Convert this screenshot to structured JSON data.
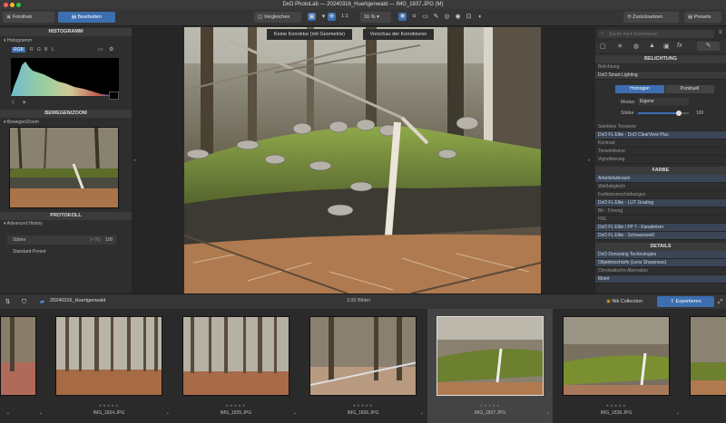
{
  "window": {
    "title": "DxO PhotoLab — 20240316_Huertgenwald — IMG_1837.JPG (M)"
  },
  "tabs": {
    "library": "Fotothek",
    "edit": "Bearbeiten"
  },
  "toolbar": {
    "compare": "Vergleichen",
    "one_to_one": "1:1",
    "zoom": "16 %",
    "reset": "Zurücksetzen",
    "presets": "Presets"
  },
  "left": {
    "histogram_header": "HISTOGRAMM",
    "histogram_label": "Histogramm",
    "channels": [
      "RGB",
      "R",
      "G",
      "B",
      "L"
    ],
    "move_zoom_header": "BEWEGEN/ZOOM",
    "move_zoom_label": "Bewegen/Zoom",
    "history_header": "PROTOKOLL",
    "history_label": "Advanced History",
    "history_rows": [
      {
        "name": "Stärke",
        "detail": "(+70)",
        "value": "100"
      },
      {
        "name": "Standard-Preset",
        "detail": "",
        "value": ""
      }
    ]
  },
  "viewer": {
    "btn_correction": "Keine Korrektur (mit Geometrie)",
    "btn_preview": "Vorschau der Korrekturen"
  },
  "right": {
    "search_placeholder": "Suche nach Korrekturen",
    "exposure_header": "BELICHTUNG",
    "exposure_rows": [
      "Belichtung",
      "DxO Smart Lighting"
    ],
    "smart_modes": [
      "Homogen",
      "Punktuell"
    ],
    "mode_label": "Modus:",
    "mode_value": "Eigene",
    "strength_label": "Stärke",
    "strength_value": "100",
    "strength_fraction": 0.8,
    "exposure_rows2": [
      "Selektive Tonwerte",
      "DxO FL Elite - DxO ClearView Plus",
      "Kontrast",
      "Tonwertkurve",
      "Vignettierung"
    ],
    "color_header": "FARBE",
    "color_rows": [
      "Arbeitsfarbraum",
      "Weißabgleich",
      "Farbtonverschiebungen",
      "DxO FL Elite - LUT Grading",
      "Bit - Tönung",
      "HSL",
      "DxO FL Elite / FP 7 - Kanalmixer",
      "DxO FL Elite - Schwarzweiß"
    ],
    "details_header": "DETAILS",
    "details_rows": [
      "DxO Denoising Technologies",
      "Objektivschärfe (Lens Sharpness)",
      "Chromatische Aberration",
      "Moiré"
    ]
  },
  "filmbar": {
    "folder": "20240316_Huertgenwald",
    "count": "1/32 Bilder",
    "nik": "Nik Collection",
    "export": "Exportieren"
  },
  "filmstrip": {
    "items": [
      {
        "name": ""
      },
      {
        "name": "IMG_1834.JPG"
      },
      {
        "name": "IMG_1835.JPG"
      },
      {
        "name": "IMG_1836.JPG"
      },
      {
        "name": "IMG_1837.JPG"
      },
      {
        "name": "IMG_1838.JPG"
      },
      {
        "name": ""
      }
    ],
    "stars": "★★★★★"
  },
  "colors": {
    "accent": "#3d6fb0",
    "panel": "#2e2e2e",
    "header": "#3b3b3b"
  }
}
